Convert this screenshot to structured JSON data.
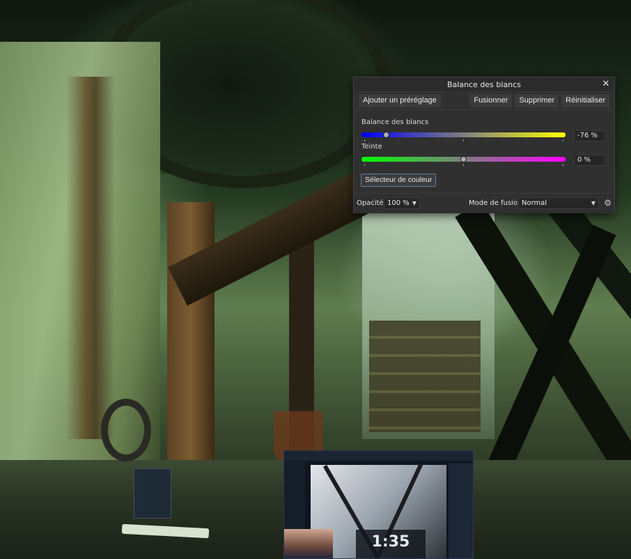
{
  "panel": {
    "title": "Balance des blancs",
    "close_icon": "close-icon",
    "toolbar": {
      "add_preset": "Ajouter un préréglage",
      "merge": "Fusionner",
      "delete": "Supprimer",
      "reset": "Réinitialiser"
    },
    "white_balance": {
      "label": "Balance des blancs",
      "value": "-76 %",
      "level": -0.76,
      "gradient": [
        "#0000ff",
        "#ffff00"
      ]
    },
    "tint": {
      "label": "Teinte",
      "value": "0 %",
      "level": 0,
      "gradient": [
        "#00ff00",
        "#ff00ff"
      ]
    },
    "color_picker": "Sélecteur de couleur",
    "footer": {
      "opacity_label": "Opacité:",
      "opacity_value": "100 %",
      "blend_label": "Mode de fusion:",
      "blend_value": "Normal",
      "settings_icon": "gear-icon"
    }
  },
  "video_overlay": {
    "timer": "1:35"
  }
}
